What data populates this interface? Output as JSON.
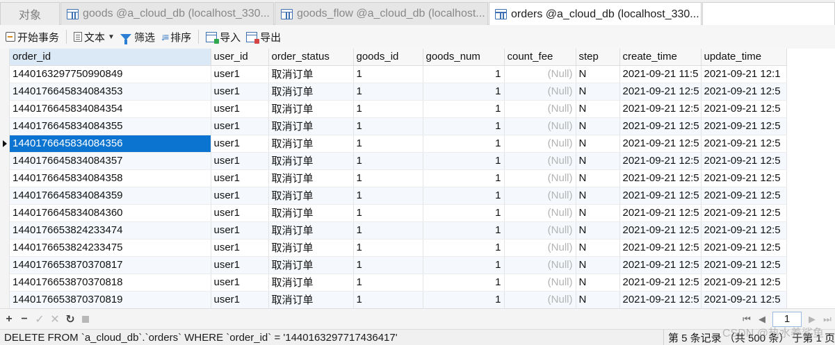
{
  "tabs": {
    "objects": "对象",
    "items": [
      {
        "label": "goods @a_cloud_db (localhost_330..."
      },
      {
        "label": "goods_flow @a_cloud_db (localhost..."
      },
      {
        "label": "orders @a_cloud_db (localhost_330..."
      }
    ],
    "active_index": 2
  },
  "toolbar": {
    "begin_transaction": "开始事务",
    "text": "文本",
    "filter": "筛选",
    "sort": "排序",
    "import": "导入",
    "export": "导出"
  },
  "grid": {
    "columns": [
      "order_id",
      "user_id",
      "order_status",
      "goods_id",
      "goods_num",
      "count_fee",
      "step",
      "create_time",
      "update_time"
    ],
    "selected_column": 0,
    "selected_row": 4,
    "rows": [
      [
        "1440163297750990849",
        "user1",
        "取消订单",
        "1",
        "1",
        "(Null)",
        "N",
        "2021-09-21 11:5",
        "2021-09-21 12:1"
      ],
      [
        "1440176645834084353",
        "user1",
        "取消订单",
        "1",
        "1",
        "(Null)",
        "N",
        "2021-09-21 12:5",
        "2021-09-21 12:5"
      ],
      [
        "1440176645834084354",
        "user1",
        "取消订单",
        "1",
        "1",
        "(Null)",
        "N",
        "2021-09-21 12:5",
        "2021-09-21 12:5"
      ],
      [
        "1440176645834084355",
        "user1",
        "取消订单",
        "1",
        "1",
        "(Null)",
        "N",
        "2021-09-21 12:5",
        "2021-09-21 12:5"
      ],
      [
        "1440176645834084356",
        "user1",
        "取消订单",
        "1",
        "1",
        "(Null)",
        "N",
        "2021-09-21 12:5",
        "2021-09-21 12:5"
      ],
      [
        "1440176645834084357",
        "user1",
        "取消订单",
        "1",
        "1",
        "(Null)",
        "N",
        "2021-09-21 12:5",
        "2021-09-21 12:5"
      ],
      [
        "1440176645834084358",
        "user1",
        "取消订单",
        "1",
        "1",
        "(Null)",
        "N",
        "2021-09-21 12:5",
        "2021-09-21 12:5"
      ],
      [
        "1440176645834084359",
        "user1",
        "取消订单",
        "1",
        "1",
        "(Null)",
        "N",
        "2021-09-21 12:5",
        "2021-09-21 12:5"
      ],
      [
        "1440176645834084360",
        "user1",
        "取消订单",
        "1",
        "1",
        "(Null)",
        "N",
        "2021-09-21 12:5",
        "2021-09-21 12:5"
      ],
      [
        "1440176653824233474",
        "user1",
        "取消订单",
        "1",
        "1",
        "(Null)",
        "N",
        "2021-09-21 12:5",
        "2021-09-21 12:5"
      ],
      [
        "1440176653824233475",
        "user1",
        "取消订单",
        "1",
        "1",
        "(Null)",
        "N",
        "2021-09-21 12:5",
        "2021-09-21 12:5"
      ],
      [
        "1440176653870370817",
        "user1",
        "取消订单",
        "1",
        "1",
        "(Null)",
        "N",
        "2021-09-21 12:5",
        "2021-09-21 12:5"
      ],
      [
        "1440176653870370818",
        "user1",
        "取消订单",
        "1",
        "1",
        "(Null)",
        "N",
        "2021-09-21 12:5",
        "2021-09-21 12:5"
      ],
      [
        "1440176653870370819",
        "user1",
        "取消订单",
        "1",
        "1",
        "(Null)",
        "N",
        "2021-09-21 12:5",
        "2021-09-21 12:5"
      ]
    ]
  },
  "navbar": {
    "add": "+",
    "delete": "−",
    "apply": "✓",
    "discard": "✕",
    "refresh": "↻",
    "page_value": "1"
  },
  "status": {
    "sql": "DELETE FROM `a_cloud_db`.`orders` WHERE `order_id` = '1440163297717436417'",
    "records": "第 5 条记录 （共 500 条） 于第 1 页",
    "watermark": "CSDN @热水养鲨鱼"
  }
}
